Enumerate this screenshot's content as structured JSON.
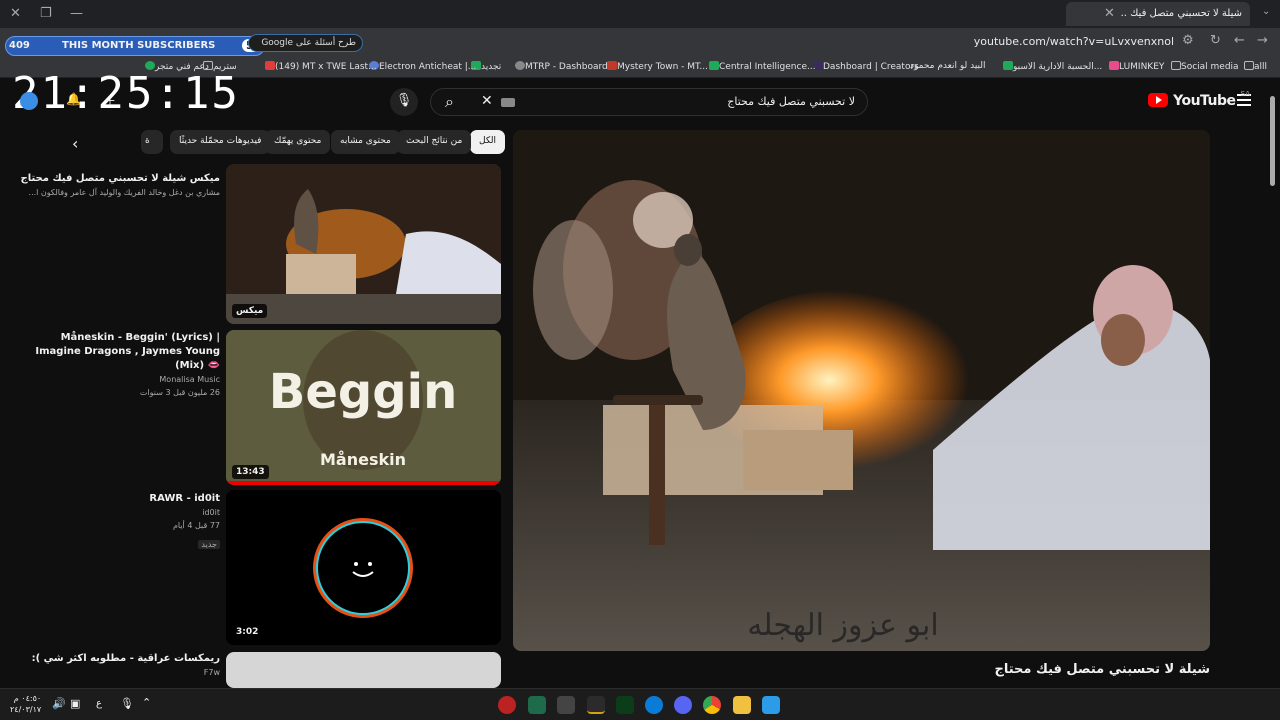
{
  "browser": {
    "tab_title": "شيلة لا تحسبني متصل فيك ..",
    "url": "youtube.com/watch?v=uLvxvenxnol",
    "bookmarks": [
      "alll",
      "Social media",
      "LUMINKEY",
      "الحسبة الادارية الاسبو...",
      "البيد لو انعدم محمود",
      "Dashboard | Creators",
      "Central Intelligence...",
      "Mystery Town - MT...",
      "MTRP - Dashboard",
      "تجديد",
      "Electron Anticheat |...",
      "(149) MT x TWE Last...",
      "ستريم",
      "دعم فني متجر"
    ]
  },
  "overlay": {
    "sub_count": "409",
    "sub_label": "THIS MONTH SUBSCRIBERS",
    "sub_goal": "500",
    "clock": "21:25:15",
    "google_ask": "طرح أسئلة على Google"
  },
  "youtube": {
    "logo_text": "YouTube",
    "region": "SA",
    "search_query": "لا تحسبني متصل فيك محتاج",
    "chips": [
      "الكل",
      "من نتائج البحث",
      "محتوى مشابه",
      "محتوى يهمّك",
      "فيديوهات محمّلة حديثًا",
      "ة"
    ],
    "video_title": "شيلة لا تحسبني متصل فيك محتاج",
    "video_overlay_text": "ابو عزوز الهجله",
    "related": [
      {
        "title": "ميكس شيلة لا تحسبني متصل فيك محتاج",
        "channel": "مشاري بن دغل وخالد الفريك والوليد آل عامر وفالكون ا...",
        "stats": "",
        "badge": "ميكس",
        "duration": ""
      },
      {
        "title": "Måneskin - Beggin' (Lyrics) | Imagine Dragons , Jaymes Young (Mix) 👄",
        "channel": "Monalisa Music",
        "stats": "26 مليون  قبل 3 سنوات",
        "badge": "",
        "duration": "13:43"
      },
      {
        "title": "RAWR - id0it",
        "channel": "id0it",
        "stats": "77  قبل 4 أيام",
        "badge": "جديد",
        "duration": "3:02"
      },
      {
        "title": "ريمكسات عراقية - مطلوبه اكثر شي ):",
        "channel": "F7w",
        "stats": "",
        "badge": "",
        "duration": ""
      }
    ],
    "thumb2_text": "Beggin",
    "thumb2_sub": "Måneskin"
  },
  "taskbar": {
    "time": "٠٤:٥٠ م",
    "date": "٢٤/٠٣/١٧",
    "lang": "ع"
  }
}
